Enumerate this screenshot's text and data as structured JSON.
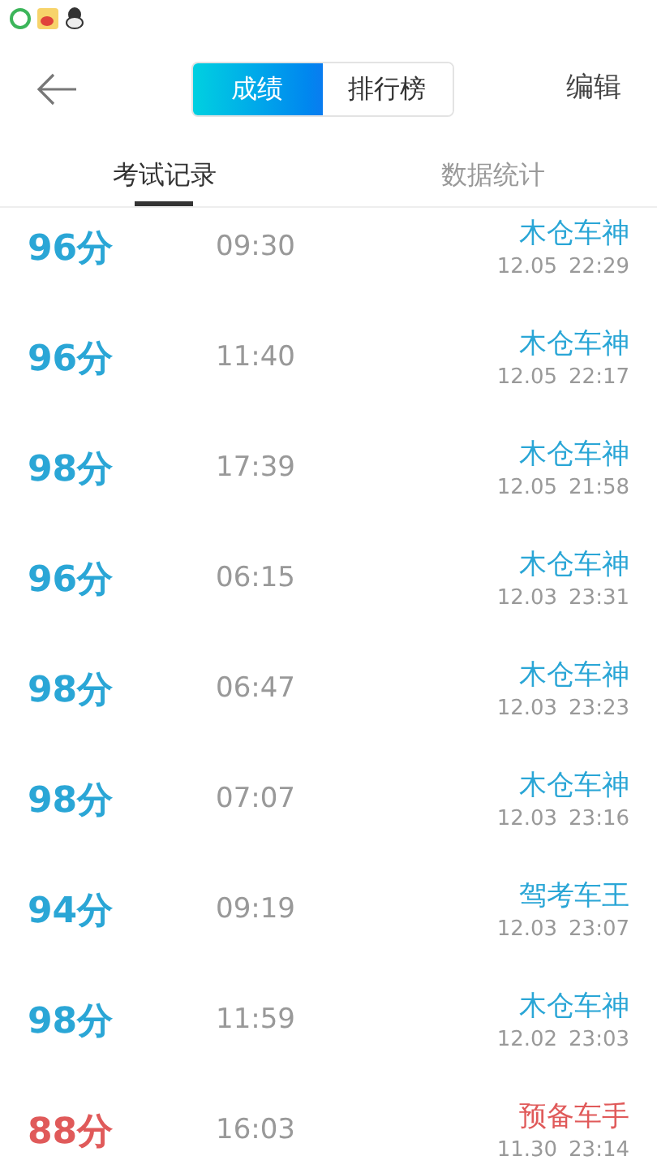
{
  "toolbar": {
    "segments": [
      {
        "label": "成绩",
        "selected": true
      },
      {
        "label": "排行榜",
        "selected": false
      }
    ],
    "edit": "编辑"
  },
  "tabs": [
    {
      "label": "考试记录",
      "selected": true
    },
    {
      "label": "数据统计",
      "selected": false
    }
  ],
  "records": [
    {
      "score": "96分",
      "duration": "09:30",
      "rank": "木仓车神",
      "date": "12.05",
      "time": "22:29",
      "color": "#2aa6d6"
    },
    {
      "score": "96分",
      "duration": "11:40",
      "rank": "木仓车神",
      "date": "12.05",
      "time": "22:17",
      "color": "#2aa6d6"
    },
    {
      "score": "98分",
      "duration": "17:39",
      "rank": "木仓车神",
      "date": "12.05",
      "time": "21:58",
      "color": "#2aa6d6"
    },
    {
      "score": "96分",
      "duration": "06:15",
      "rank": "木仓车神",
      "date": "12.03",
      "time": "23:31",
      "color": "#2aa6d6"
    },
    {
      "score": "98分",
      "duration": "06:47",
      "rank": "木仓车神",
      "date": "12.03",
      "time": "23:23",
      "color": "#2aa6d6"
    },
    {
      "score": "98分",
      "duration": "07:07",
      "rank": "木仓车神",
      "date": "12.03",
      "time": "23:16",
      "color": "#2aa6d6"
    },
    {
      "score": "94分",
      "duration": "09:19",
      "rank": "驾考车王",
      "date": "12.03",
      "time": "23:07",
      "color": "#2aa6d6"
    },
    {
      "score": "98分",
      "duration": "11:59",
      "rank": "木仓车神",
      "date": "12.02",
      "time": "23:03",
      "color": "#2aa6d6"
    },
    {
      "score": "88分",
      "duration": "16:03",
      "rank": "预备车手",
      "date": "11.30",
      "time": "23:14",
      "color": "#e05a5a"
    }
  ]
}
